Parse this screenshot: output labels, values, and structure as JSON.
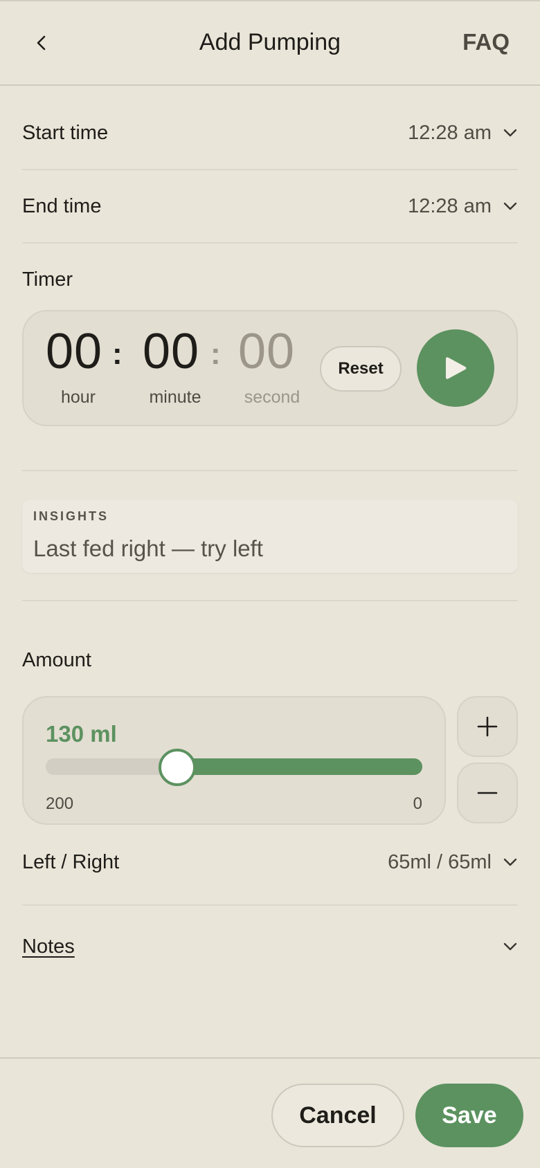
{
  "header": {
    "title": "Add Pumping",
    "faq_label": "FAQ",
    "back_icon": "chevron-left-icon"
  },
  "start_time": {
    "label": "Start time",
    "value": "12:28 am"
  },
  "end_time": {
    "label": "End time",
    "value": "12:28 am"
  },
  "timer": {
    "label": "Timer",
    "hour": "00",
    "minute": "00",
    "second": "00",
    "separator": ":",
    "hour_label": "hour",
    "minute_label": "minute",
    "second_label": "second",
    "reset_label": "Reset",
    "play_icon": "play-icon"
  },
  "insights": {
    "label": "INSIGHTS",
    "text": "Last fed right — try left"
  },
  "amount": {
    "label": "Amount",
    "value_text": "130 ml",
    "value": 130,
    "scale_left": "200",
    "scale_right": "0",
    "scale_min": 0,
    "scale_max": 200,
    "increment_icon": "plus-icon",
    "decrement_icon": "minus-icon"
  },
  "left_right": {
    "label": "Left / Right",
    "value": "65ml / 65ml"
  },
  "notes": {
    "label": "Notes"
  },
  "footer": {
    "cancel_label": "Cancel",
    "save_label": "Save"
  },
  "colors": {
    "background": "#e9e5d9",
    "accent": "#5c9260",
    "text": "#1f1d19",
    "muted": "#514d45"
  }
}
